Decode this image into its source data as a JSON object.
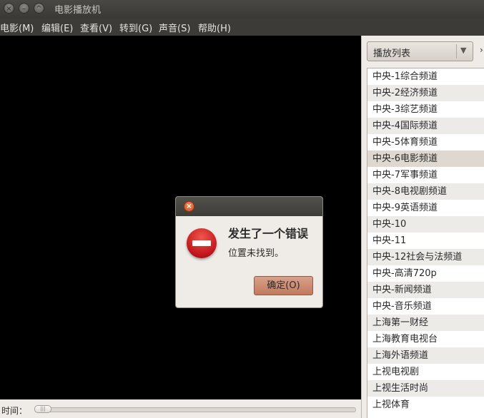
{
  "window": {
    "title": "电影播放机",
    "controls": [
      "close-icon",
      "minimize-icon",
      "maximize-icon"
    ]
  },
  "menubar": {
    "items": [
      "电影(M)",
      "编辑(E)",
      "查看(V)",
      "转到(G)",
      "声音(S)",
      "帮助(H)"
    ]
  },
  "sidebar": {
    "combo_label": "播放列表",
    "playlist": [
      "中央-1综合频道",
      "中央-2经济频道",
      "中央-3综艺频道",
      "中央-4国际频道",
      "中央-5体育频道",
      "中央-6电影频道",
      "中央-7军事频道",
      "中央-8电视剧频道",
      "中央-9英语频道",
      "中央-10",
      "中央-11",
      "中央-12社会与法频道",
      "中央-高清720p",
      "中央-新闻频道",
      "中央-音乐频道",
      "上海第一财经",
      "上海教育电视台",
      "上海外语频道",
      "上视电视剧",
      "上视生活时尚",
      "上视体育"
    ],
    "selected_index": 5
  },
  "bottom": {
    "time_label": "时间："
  },
  "dialog": {
    "heading": "发生了一个错误",
    "message": "位置未找到。",
    "ok_label": "确定(O)"
  },
  "colors": {
    "titlebar": "#3b3935",
    "menubar": "#3c3b37",
    "video": "#000000",
    "window_bg": "#efebe7",
    "selected_row": "#ded8d0",
    "ok_button": "#c98a71",
    "error_icon": "#c0141c"
  }
}
